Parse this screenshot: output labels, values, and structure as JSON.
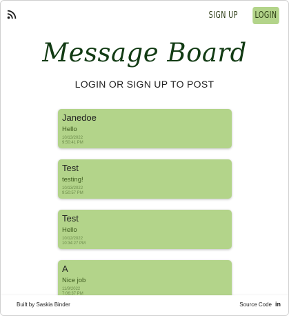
{
  "header": {
    "rss_icon": "rss-icon",
    "signup_label": "SIGN UP",
    "login_label": "LOGIN",
    "accent_color": "#b3d48a"
  },
  "main": {
    "title": "Message Board",
    "subtitle": "LOGIN OR SIGN UP TO POST",
    "title_color": "#123b14"
  },
  "posts": [
    {
      "author": "Janedoe",
      "message": "Hello",
      "date": "10/13/2022",
      "time": "9:50:41 PM"
    },
    {
      "author": "Test",
      "message": "testing!",
      "date": "10/13/2022",
      "time": "9:50:57 PM"
    },
    {
      "author": "Test",
      "message": "Hello",
      "date": "10/12/2022",
      "time": "10:34:27 PM"
    },
    {
      "author": "A",
      "message": "Nice job",
      "date": "11/9/2022",
      "time": "7:06:37 PM"
    }
  ],
  "footer": {
    "credit": "Built by Saskia Binder",
    "source_label": "Source Code",
    "linkedin_icon": "linkedin-icon",
    "linkedin_glyph": "in"
  }
}
